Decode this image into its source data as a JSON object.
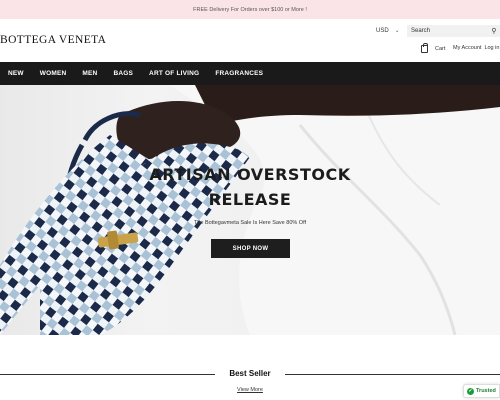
{
  "announcement": "FREE Delivery For Orders over $100 or More !",
  "header": {
    "logo": "BOTTEGA VENETA",
    "currency": "USD",
    "search_placeholder": "Search",
    "cart_label": "Cart",
    "account_label": "My Account",
    "login_label": "Log in"
  },
  "nav": {
    "items": [
      "NEW",
      "WOMEN",
      "MEN",
      "BAGS",
      "ART OF LIVING",
      "FRAGRANCES"
    ]
  },
  "hero": {
    "title_line1": "ARTISAN OVERSTOCK",
    "title_line2": "RELEASE",
    "subtitle": "The Bottegavmeta Sale Is Here Save 80% Off",
    "cta": "SHOP NOW"
  },
  "best_seller": {
    "title": "Best Seller",
    "view_more": "View More"
  },
  "trust_badge": {
    "label": "Trusted"
  },
  "colors": {
    "announcement_bg": "#fbe4e8",
    "nav_bg": "#1a1a1a",
    "cta_bg": "#1e1e1e",
    "bag_navy": "#1c2a4a",
    "bag_light_blue": "#a9c2d6"
  },
  "icons": [
    "chevron-down-icon",
    "search-icon",
    "cart-icon",
    "check-icon"
  ]
}
